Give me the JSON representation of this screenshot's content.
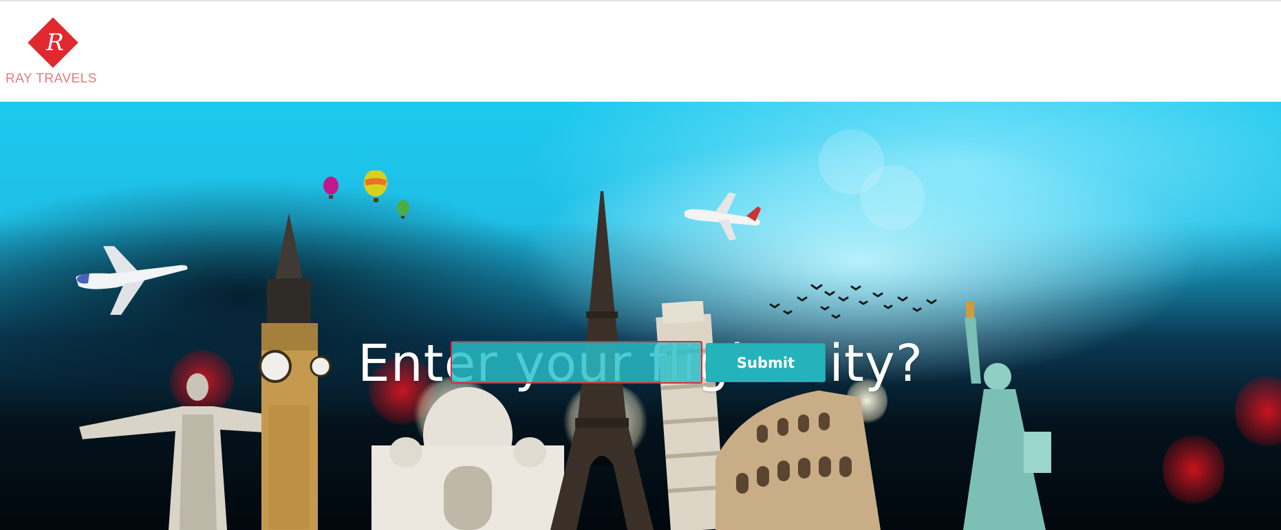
{
  "header": {
    "logo_letter": "R",
    "logo_text": "RAY TRAVELS"
  },
  "hero": {
    "title": "Enter your flight city?",
    "search": {
      "value": "",
      "placeholder": ""
    },
    "submit_label": "Submit"
  },
  "colors": {
    "brand_red": "#e0292f",
    "button_teal": "#24b3bb",
    "input_border": "#d92a33"
  }
}
